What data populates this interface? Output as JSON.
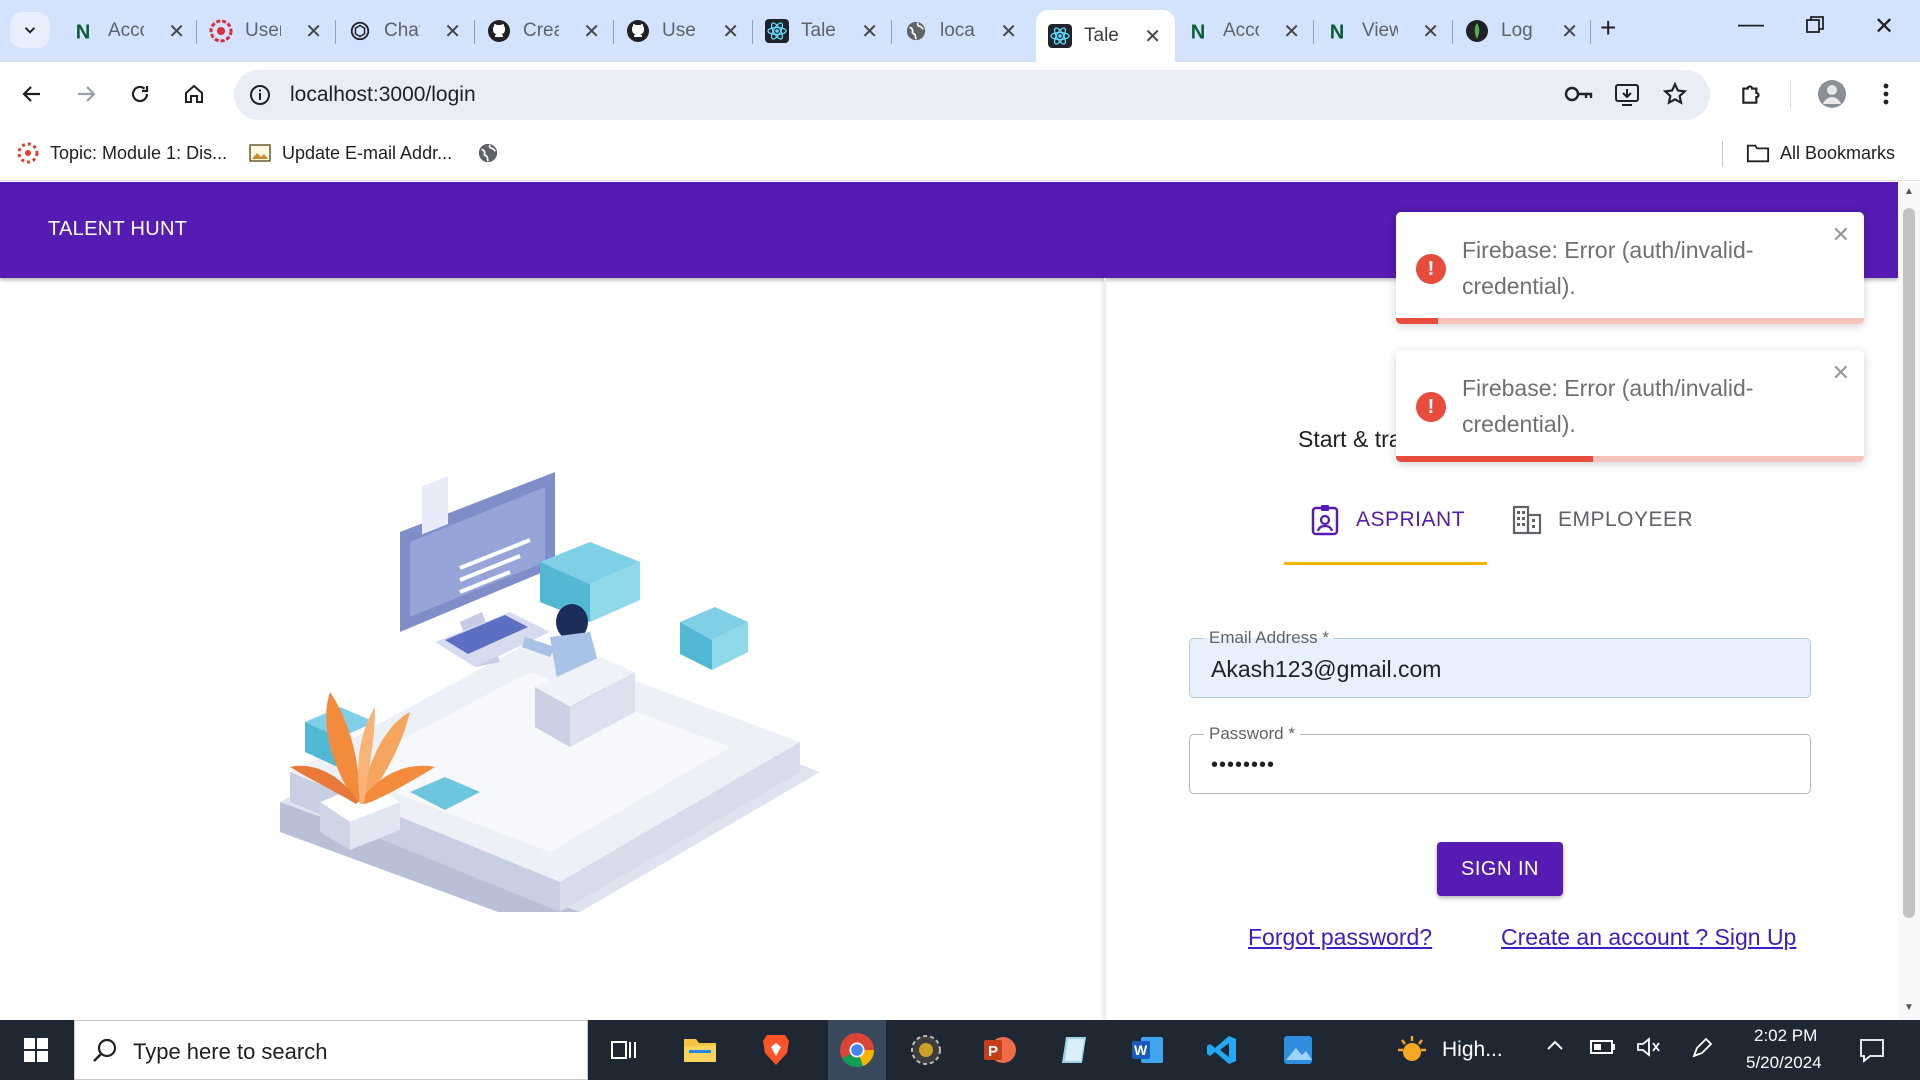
{
  "browser": {
    "tabs": [
      {
        "label": "Acco",
        "icon": "notion-icon",
        "active": false
      },
      {
        "label": "User",
        "icon": "angular-icon",
        "active": false
      },
      {
        "label": "Chat",
        "icon": "openai-icon",
        "active": false
      },
      {
        "label": "Crea",
        "icon": "github-icon",
        "active": false
      },
      {
        "label": "Use",
        "icon": "github-icon",
        "active": false
      },
      {
        "label": "Tale",
        "icon": "react-icon",
        "active": false
      },
      {
        "label": "loca",
        "icon": "globe-icon",
        "active": false
      },
      {
        "label": "Talen",
        "icon": "react-icon",
        "active": true
      },
      {
        "label": "Acco",
        "icon": "notion-icon",
        "active": false
      },
      {
        "label": "View",
        "icon": "notion-icon",
        "active": false
      },
      {
        "label": "Log",
        "icon": "mongodb-icon",
        "active": false
      }
    ],
    "url": "localhost:3000/login",
    "bookmarks": [
      {
        "label": "Topic: Module 1: Dis..."
      },
      {
        "label": "Update E-mail Addr..."
      }
    ],
    "all_bookmarks_label": "All Bookmarks"
  },
  "app": {
    "brand": "TALENT HUNT",
    "start_text": "Start & tra",
    "tabs": {
      "aspirant": "ASPRIANT",
      "employer": "EMPLOYEER"
    },
    "form": {
      "email_label": "Email Address *",
      "email_value": "Akash123@gmail.com",
      "password_label": "Password *",
      "password_value": "••••••••",
      "signin_label": "SIGN IN",
      "forgot_label": "Forgot password?",
      "signup_label": "Create an account ? Sign Up"
    },
    "toasts": [
      {
        "message": "Firebase: Error (auth/invalid-credential).",
        "progress": 0.09
      },
      {
        "message": "Firebase: Error (auth/invalid-credential).",
        "progress": 0.42
      }
    ]
  },
  "taskbar": {
    "search_placeholder": "Type here to search",
    "weather_label": "High...",
    "time": "2:02 PM",
    "date": "5/20/2024"
  },
  "colors": {
    "brand_purple": "#551bb2",
    "tab_indicator": "#f5b400",
    "error_red": "#e74c3c"
  }
}
